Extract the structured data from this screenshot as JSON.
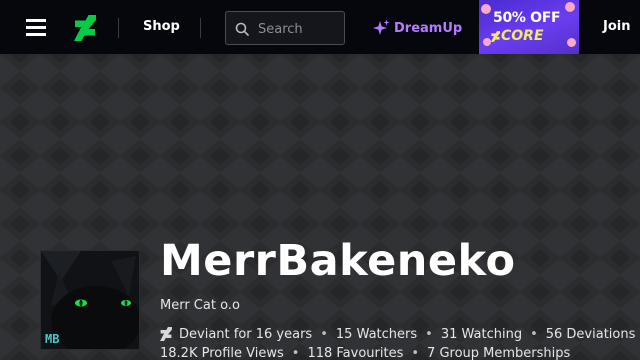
{
  "nav": {
    "menu_icon": "hamburger-menu-icon",
    "logo_icon": "deviantart-logo-icon",
    "shop_label": "Shop",
    "search": {
      "placeholder": "Search",
      "icon": "search-icon"
    },
    "dreamup": {
      "label": "DreamUp",
      "icon": "sparkle-icon",
      "color": "#b57cff"
    },
    "promo": {
      "line1": "50% OFF",
      "line2": "CORE",
      "icon": "core-logo-icon"
    },
    "join_label": "Join"
  },
  "profile": {
    "username": "MerrBakeneko",
    "tagline": "Merr Cat o.o",
    "avatar_initials": "MB",
    "stats_line1": {
      "deviant_for": "Deviant for 16 years",
      "watchers": "15 Watchers",
      "watching": "31 Watching",
      "deviations": "56 Deviations"
    },
    "stats_line2": {
      "profile_views": "18.2K Profile Views",
      "favourites": "118 Favourites",
      "group_memberships": "7 Group Memberships"
    }
  },
  "colors": {
    "nav_background": "#06070d",
    "brand_green": "#05cc47",
    "banner_background": "#2b2c2e",
    "accent_purple": "#b57cff"
  }
}
